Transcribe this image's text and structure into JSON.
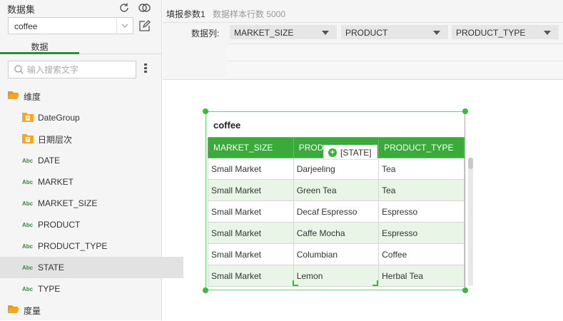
{
  "left_panel": {
    "title": "数据集",
    "dataset_value": "coffee",
    "tab_label": "数据",
    "search_placeholder": "输入搜索文字",
    "tree": [
      {
        "label": "维度",
        "type": "folder-open"
      },
      {
        "label": "DateGroup",
        "type": "folder-doc"
      },
      {
        "label": "日期层次",
        "type": "folder-doc"
      },
      {
        "label": "DATE",
        "type": "field",
        "tag": "Abc"
      },
      {
        "label": "MARKET",
        "type": "field",
        "tag": "Abc"
      },
      {
        "label": "MARKET_SIZE",
        "type": "field",
        "tag": "Abc"
      },
      {
        "label": "PRODUCT",
        "type": "field",
        "tag": "Abc"
      },
      {
        "label": "PRODUCT_TYPE",
        "type": "field",
        "tag": "Abc"
      },
      {
        "label": "STATE",
        "type": "field",
        "tag": "Abc",
        "selected": true
      },
      {
        "label": "TYPE",
        "type": "field",
        "tag": "Abc"
      },
      {
        "label": "度量",
        "type": "folder-open"
      }
    ]
  },
  "topbar": {
    "param_name": "填报参数1",
    "sample_rows": "数据样本行数 5000"
  },
  "column_bar": {
    "label": "数据列:",
    "selects": [
      "MARKET_SIZE",
      "PRODUCT",
      "PRODUCT_TYPE"
    ]
  },
  "widget": {
    "title": "coffee",
    "headers": [
      "MARKET_SIZE",
      "PRODUCT",
      "PRODUCT_TYPE"
    ],
    "header_product_visible": "PROD",
    "rows": [
      [
        "Small Market",
        "Darjeeling",
        "Tea"
      ],
      [
        "Small Market",
        "Green Tea",
        "Tea"
      ],
      [
        "Small Market",
        "Decaf Espresso",
        "Espresso"
      ],
      [
        "Small Market",
        "Caffe Mocha",
        "Espresso"
      ],
      [
        "Small Market",
        "Columbian",
        "Coffee"
      ],
      [
        "Small Market",
        "Lemon",
        "Herbal Tea"
      ]
    ],
    "drop_tooltip": "[STATE]"
  },
  "colors": {
    "accent": "#3aaa3a",
    "row_alt": "#e9f6e7",
    "selected_item": "#e2e2e2",
    "folder": "#f5a623"
  }
}
